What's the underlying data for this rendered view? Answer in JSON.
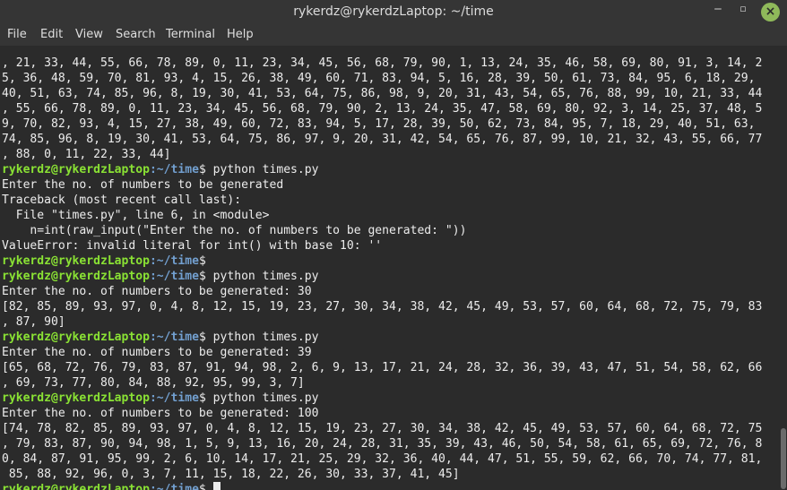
{
  "window": {
    "title": "rykerdz@rykerdzLaptop: ~/time",
    "minimize_glyph": "‒",
    "maximize_glyph": "▫",
    "close_glyph": "×"
  },
  "menu": [
    "File",
    "Edit",
    "View",
    "Search",
    "Terminal",
    "Help"
  ],
  "prompt": {
    "user_host": "rykerdz@rykerdzLaptop",
    "path": ":~/time",
    "symbol": "$ "
  },
  "lines": [
    {
      "t": ", 21, 33, 44, 55, 66, 78, 89, 0, 11, 23, 34, 45, 56, 68, 79, 90, 1, 13, 24, 35, 46, 58, 69, 80, 91, 3, 14, 2"
    },
    {
      "t": "5, 36, 48, 59, 70, 81, 93, 4, 15, 26, 38, 49, 60, 71, 83, 94, 5, 16, 28, 39, 50, 61, 73, 84, 95, 6, 18, 29,"
    },
    {
      "t": "40, 51, 63, 74, 85, 96, 8, 19, 30, 41, 53, 64, 75, 86, 98, 9, 20, 31, 43, 54, 65, 76, 88, 99, 10, 21, 33, 44"
    },
    {
      "t": ", 55, 66, 78, 89, 0, 11, 23, 34, 45, 56, 68, 79, 90, 2, 13, 24, 35, 47, 58, 69, 80, 92, 3, 14, 25, 37, 48, 5"
    },
    {
      "t": "9, 70, 82, 93, 4, 15, 27, 38, 49, 60, 72, 83, 94, 5, 17, 28, 39, 50, 62, 73, 84, 95, 7, 18, 29, 40, 51, 63,"
    },
    {
      "t": "74, 85, 96, 8, 19, 30, 41, 53, 64, 75, 86, 97, 9, 20, 31, 42, 54, 65, 76, 87, 99, 10, 21, 32, 43, 55, 66, 77"
    },
    {
      "t": ", 88, 0, 11, 22, 33, 44]"
    },
    {
      "p": true,
      "t": "python times.py"
    },
    {
      "t": "Enter the no. of numbers to be generated"
    },
    {
      "t": "Traceback (most recent call last):"
    },
    {
      "t": "  File \"times.py\", line 6, in <module>"
    },
    {
      "t": "    n=int(raw_input(\"Enter the no. of numbers to be generated: \"))"
    },
    {
      "t": "ValueError: invalid literal for int() with base 10: ''"
    },
    {
      "p": true,
      "t": ""
    },
    {
      "p": true,
      "t": "python times.py"
    },
    {
      "t": "Enter the no. of numbers to be generated: 30"
    },
    {
      "t": "[82, 85, 89, 93, 97, 0, 4, 8, 12, 15, 19, 23, 27, 30, 34, 38, 42, 45, 49, 53, 57, 60, 64, 68, 72, 75, 79, 83"
    },
    {
      "t": ", 87, 90]"
    },
    {
      "p": true,
      "t": "python times.py"
    },
    {
      "t": "Enter the no. of numbers to be generated: 39"
    },
    {
      "t": "[65, 68, 72, 76, 79, 83, 87, 91, 94, 98, 2, 6, 9, 13, 17, 21, 24, 28, 32, 36, 39, 43, 47, 51, 54, 58, 62, 66"
    },
    {
      "t": ", 69, 73, 77, 80, 84, 88, 92, 95, 99, 3, 7]"
    },
    {
      "p": true,
      "t": "python times.py"
    },
    {
      "t": "Enter the no. of numbers to be generated: 100"
    },
    {
      "t": "[74, 78, 82, 85, 89, 93, 97, 0, 4, 8, 12, 15, 19, 23, 27, 30, 34, 38, 42, 45, 49, 53, 57, 60, 64, 68, 72, 75"
    },
    {
      "t": ", 79, 83, 87, 90, 94, 98, 1, 5, 9, 13, 16, 20, 24, 28, 31, 35, 39, 43, 46, 50, 54, 58, 61, 65, 69, 72, 76, 8"
    },
    {
      "t": "0, 84, 87, 91, 95, 99, 2, 6, 10, 14, 17, 21, 25, 29, 32, 36, 40, 44, 47, 51, 55, 59, 62, 66, 70, 74, 77, 81,"
    },
    {
      "t": " 85, 88, 92, 96, 0, 3, 7, 11, 15, 18, 22, 26, 30, 33, 37, 41, 45]"
    },
    {
      "p": true,
      "t": "",
      "cursor": true
    }
  ],
  "colors": {
    "background": "#2b2b2b",
    "foreground": "#ececec",
    "prompt_user": "#8ae234",
    "prompt_path": "#729fcf",
    "close_button": "#8fb95a"
  }
}
